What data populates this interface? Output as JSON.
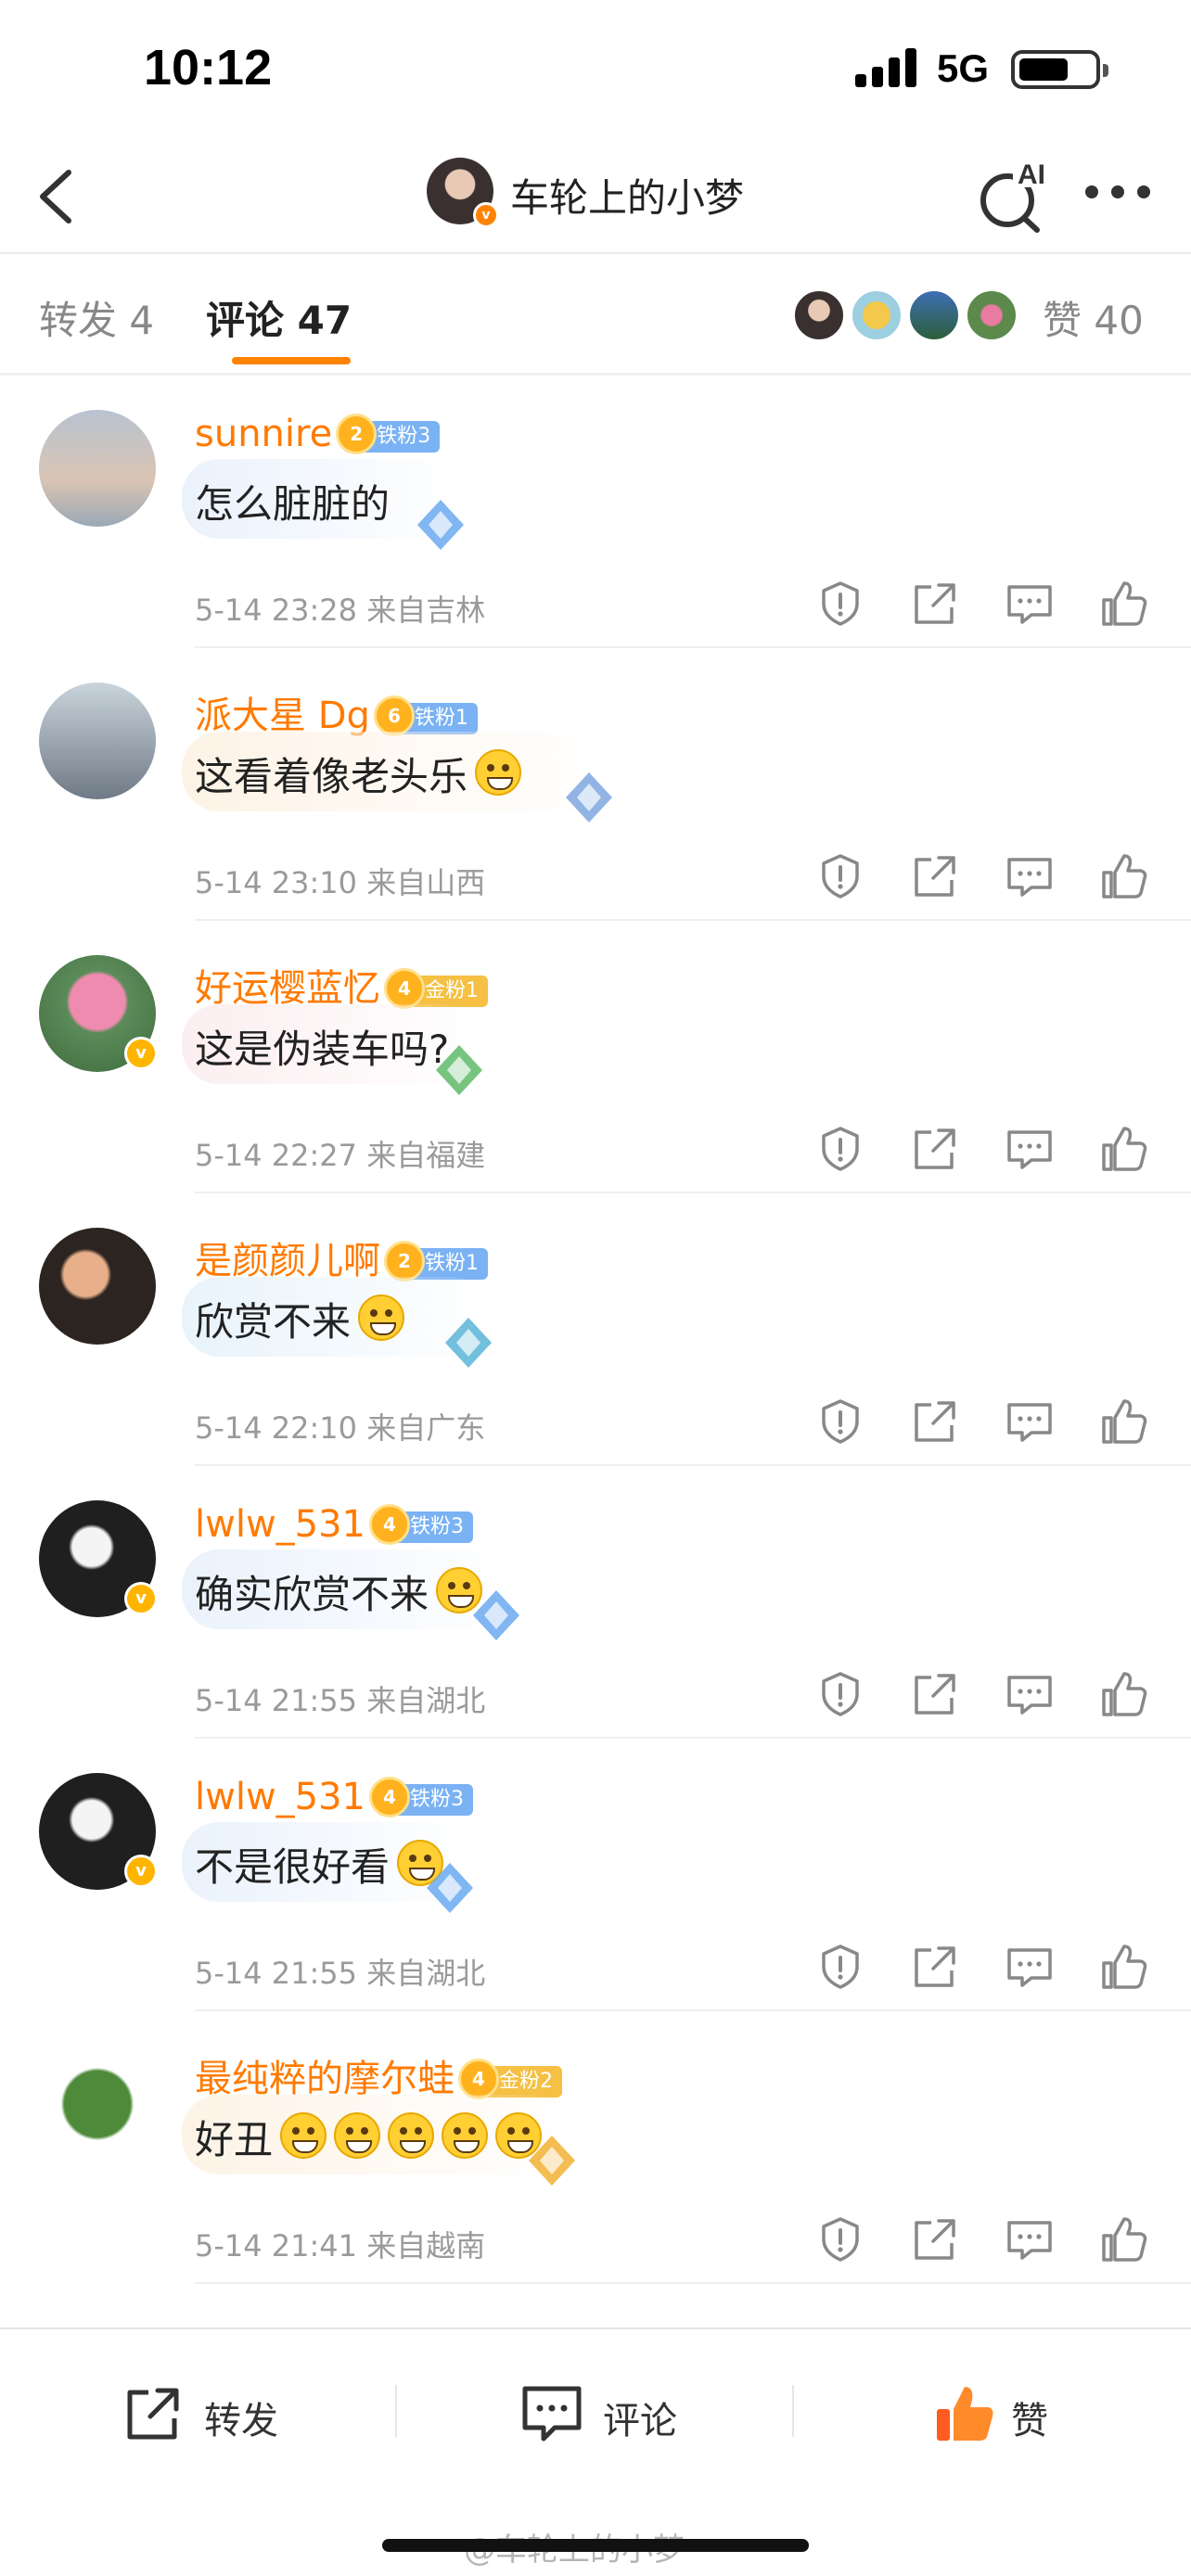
{
  "status_bar": {
    "time": "10:12",
    "network": "5G"
  },
  "nav": {
    "title": "车轮上的小梦",
    "ai_label": "AI"
  },
  "tabs": {
    "repost_label": "转发 4",
    "comment_label": "评论 47",
    "likes_label": "赞 40"
  },
  "colors": {
    "accent": "#ff8200",
    "username": "#ff7a00",
    "meta": "#9a9a9a"
  },
  "comments": [
    {
      "username": "sunnire",
      "badge": "铁粉3",
      "badge_level": "2",
      "text": "怎么脏脏的",
      "time": "5-14 23:28",
      "location": "来自吉林",
      "emojis": 0
    },
    {
      "username": "派大星 Dg",
      "badge": "铁粉1",
      "badge_level": "6",
      "text": "这看着像老头乐",
      "time": "5-14 23:10",
      "location": "来自山西",
      "emojis": 1
    },
    {
      "username": "好运樱蓝忆",
      "badge": "金粉1",
      "badge_level": "4",
      "text": "这是伪装车吗?",
      "time": "5-14 22:27",
      "location": "来自福建",
      "emojis": 0
    },
    {
      "username": "是颜颜儿啊",
      "badge": "铁粉1",
      "badge_level": "2",
      "text": "欣赏不来",
      "time": "5-14 22:10",
      "location": "来自广东",
      "emojis": 1
    },
    {
      "username": "lwlw_531",
      "badge": "铁粉3",
      "badge_level": "4",
      "text": "确实欣赏不来",
      "time": "5-14 21:55",
      "location": "来自湖北",
      "emojis": 1
    },
    {
      "username": "lwlw_531",
      "badge": "铁粉3",
      "badge_level": "4",
      "text": "不是很好看",
      "time": "5-14 21:55",
      "location": "来自湖北",
      "emojis": 1
    },
    {
      "username": "最纯粹的摩尔蛙",
      "badge": "金粉2",
      "badge_level": "4",
      "text": "好丑",
      "time": "5-14 21:41",
      "location": "来自越南",
      "emojis": 5
    }
  ],
  "bottom_bar": {
    "repost": "转发",
    "comment": "评论",
    "like": "赞"
  },
  "watermark": "@车轮上的小梦"
}
